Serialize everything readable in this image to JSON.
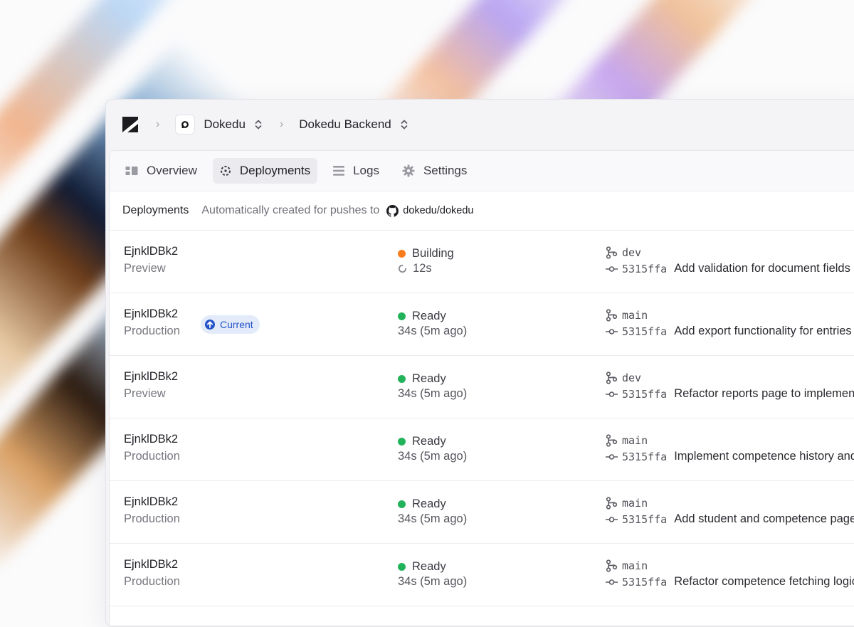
{
  "colors": {
    "building": "#f97c1c",
    "ready": "#22b35a",
    "badge_bg": "#e3ebfb",
    "badge_fg": "#2454c8"
  },
  "breadcrumb": {
    "logo_icon": "app-logo-icon",
    "team": "Dokedu",
    "project": "Dokedu Backend"
  },
  "tabs": [
    {
      "label": "Overview",
      "icon": "overview-icon",
      "active": false
    },
    {
      "label": "Deployments",
      "icon": "deployments-icon",
      "active": true
    },
    {
      "label": "Logs",
      "icon": "logs-icon",
      "active": false
    },
    {
      "label": "Settings",
      "icon": "gear-icon",
      "active": false
    }
  ],
  "subheader": {
    "title": "Deployments",
    "description": "Automatically created for pushes to",
    "repo": "dokedu/dokedu"
  },
  "deployments": [
    {
      "id": "EjnklDBk2",
      "env": "Preview",
      "badge": "",
      "status": "Building",
      "status_color": "#f97c1c",
      "duration": "12s",
      "spinner": true,
      "branch": "dev",
      "sha": "5315ffa",
      "message": "Add validation for document fields"
    },
    {
      "id": "EjnklDBk2",
      "env": "Production",
      "badge": "Current",
      "status": "Ready",
      "status_color": "#22b35a",
      "duration": "34s (5m ago)",
      "spinner": false,
      "branch": "main",
      "sha": "5315ffa",
      "message": "Add export functionality for entries"
    },
    {
      "id": "EjnklDBk2",
      "env": "Preview",
      "badge": "",
      "status": "Ready",
      "status_color": "#22b35a",
      "duration": "34s (5m ago)",
      "spinner": false,
      "branch": "dev",
      "sha": "5315ffa",
      "message": "Refactor reports page to implement"
    },
    {
      "id": "EjnklDBk2",
      "env": "Production",
      "badge": "",
      "status": "Ready",
      "status_color": "#22b35a",
      "duration": "34s (5m ago)",
      "spinner": false,
      "branch": "main",
      "sha": "5315ffa",
      "message": "Implement competence history and"
    },
    {
      "id": "EjnklDBk2",
      "env": "Production",
      "badge": "",
      "status": "Ready",
      "status_color": "#22b35a",
      "duration": "34s (5m ago)",
      "spinner": false,
      "branch": "main",
      "sha": "5315ffa",
      "message": "Add student and competence pages"
    },
    {
      "id": "EjnklDBk2",
      "env": "Production",
      "badge": "",
      "status": "Ready",
      "status_color": "#22b35a",
      "duration": "34s (5m ago)",
      "spinner": false,
      "branch": "main",
      "sha": "5315ffa",
      "message": "Refactor competence fetching logic"
    }
  ]
}
